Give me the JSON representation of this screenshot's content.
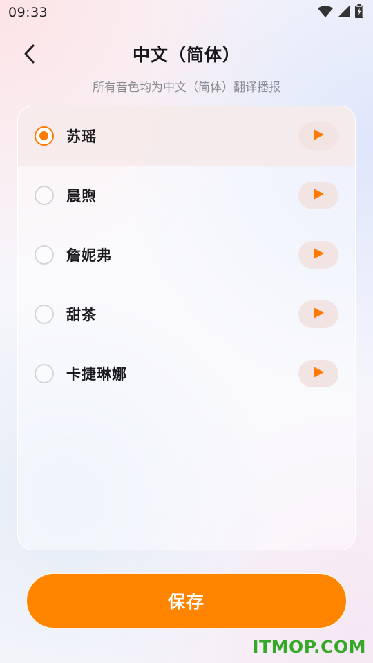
{
  "status_bar": {
    "time": "09:33",
    "icons": [
      "wifi-icon",
      "signal-icon",
      "battery-icon"
    ]
  },
  "header": {
    "title": "中文（简体）",
    "subtitle": "所有音色均为中文（简体）翻译播报"
  },
  "voices": [
    {
      "name": "苏瑶",
      "selected": true
    },
    {
      "name": "晨煦",
      "selected": false
    },
    {
      "name": "詹妮弗",
      "selected": false
    },
    {
      "name": "甜茶",
      "selected": false
    },
    {
      "name": "卡捷琳娜",
      "selected": false
    }
  ],
  "save_button": {
    "label": "保存"
  },
  "watermark": "ITMOP.COM",
  "colors": {
    "accent": "#ff8400",
    "radio_selected": "#ff7a00",
    "play_bg": "#f1e4e3",
    "watermark": "#35a827"
  }
}
